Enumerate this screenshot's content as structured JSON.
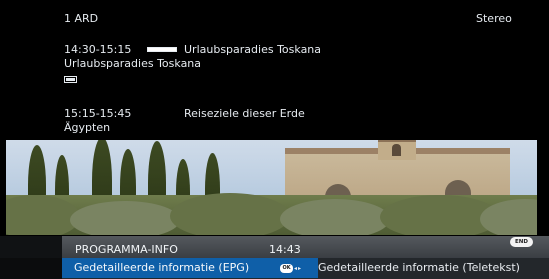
{
  "channel": {
    "number_name": "1 ARD",
    "audio": "Stereo"
  },
  "programs": [
    {
      "time": "14:30-15:15",
      "title": "Urlaubsparadies Toskana",
      "subtitle": "Urlaubsparadies Toskana",
      "progress": 0.9,
      "has_info_icon": true
    },
    {
      "time": "15:15-15:45",
      "title": "Reiseziele dieser Erde",
      "subtitle": "Ägypten"
    }
  ],
  "bottom_bar": {
    "title": "PROGRAMMA-INFO",
    "time": "14:43",
    "end_label": "END",
    "options": {
      "selected": "Gedetailleerde informatie (EPG)",
      "other": "Gedetailleerde informatie (Teletekst)"
    },
    "ok_label": "OK",
    "arrow_left": "◂",
    "arrow_right": "▸"
  },
  "icons": {
    "ok_button": "ok-button-icon",
    "end_button": "end-button-icon",
    "progress": "progress-bar-icon",
    "program_info": "program-info-icon"
  },
  "colors": {
    "selection": "#0f5fa8",
    "bar": "#45494e",
    "background": "#000000",
    "text": "#e6ebf0"
  }
}
